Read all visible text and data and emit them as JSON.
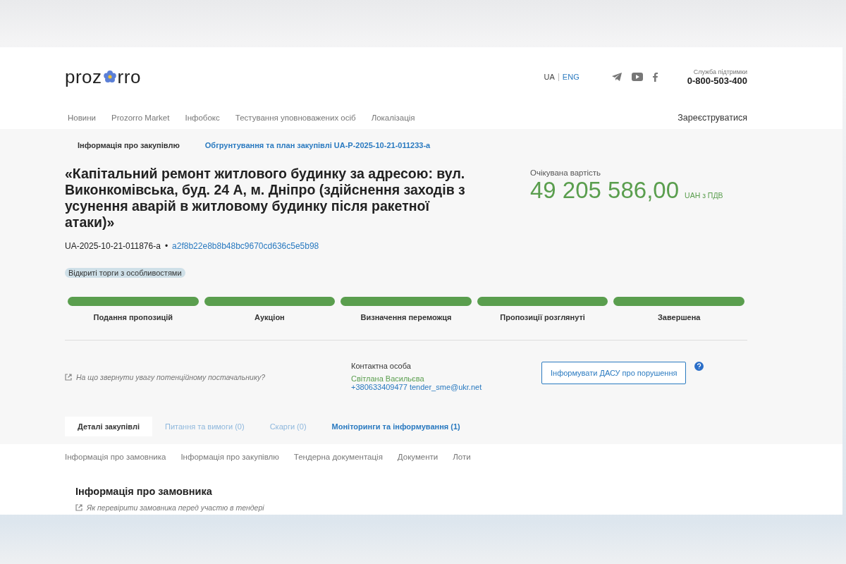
{
  "header": {
    "logo": {
      "before": "proz",
      "after": "rro"
    },
    "languages": [
      {
        "label": "UA",
        "selected": true
      },
      {
        "label": "ENG",
        "selected": false
      }
    ],
    "support": {
      "label": "Служба підтримки",
      "phone": "0-800-503-400"
    }
  },
  "nav": {
    "items": [
      "Новини",
      "Prozorro Market",
      "Інфобокс",
      "Тестування уповноважених осіб",
      "Локалізація"
    ],
    "register": "Зареєструватися"
  },
  "top_tabs": [
    {
      "label": "Інформація про закупівлю",
      "selected": true
    },
    {
      "label": "Обгрунтування та план закупівлі UA-P-2025-10-21-011233-a",
      "selected": false
    }
  ],
  "tender": {
    "title": "«Капітальний ремонт житлового будинку за адресою: вул. Виконкомівська, буд. 24 А, м. Дніпро (здійснення заходів з усунення аварій в житловому будинку після ракетної атаки)»",
    "id": "UA-2025-10-21-011876-a",
    "separator": "•",
    "hash": "a2f8b22e8b8b48bc9670cd636c5e5b98",
    "procedure": "Відкриті торги з особливостями",
    "value_label": "Очікувана вартість",
    "value": "49 205 586,00",
    "currency": "UAH з ПДВ"
  },
  "stages": [
    {
      "label": "Подання пропозицій",
      "done": true
    },
    {
      "label": "Аукціон",
      "done": true
    },
    {
      "label": "Визначення переможця",
      "done": true
    },
    {
      "label": "Пропозиції розглянуті",
      "done": true
    },
    {
      "label": "Завершена",
      "done": true
    }
  ],
  "advice_link": "На що звернути увагу потенційному постачальнику?",
  "contact": {
    "heading": "Контактна особа",
    "name": "Світлана Васильєва",
    "phone": "+380633409477",
    "email": "tender_sme@ukr.net"
  },
  "report_button": "Інформувати ДАСУ про порушення",
  "detail_tabs": [
    {
      "label": "Деталі закупівлі",
      "selected": true,
      "disabled": false
    },
    {
      "label": "Питання та вимоги (0)",
      "selected": false,
      "disabled": true
    },
    {
      "label": "Скарги (0)",
      "selected": false,
      "disabled": true
    },
    {
      "label": "Моніторинги та інформування (1)",
      "selected": false,
      "disabled": false
    }
  ],
  "sections": [
    "Інформація про замовника",
    "Інформація про закупівлю",
    "Тендерна документація",
    "Документи",
    "Лоти"
  ],
  "customer": {
    "heading": "Інформація про замовника",
    "link": "Як перевірити замовника перед участю в тендері"
  }
}
